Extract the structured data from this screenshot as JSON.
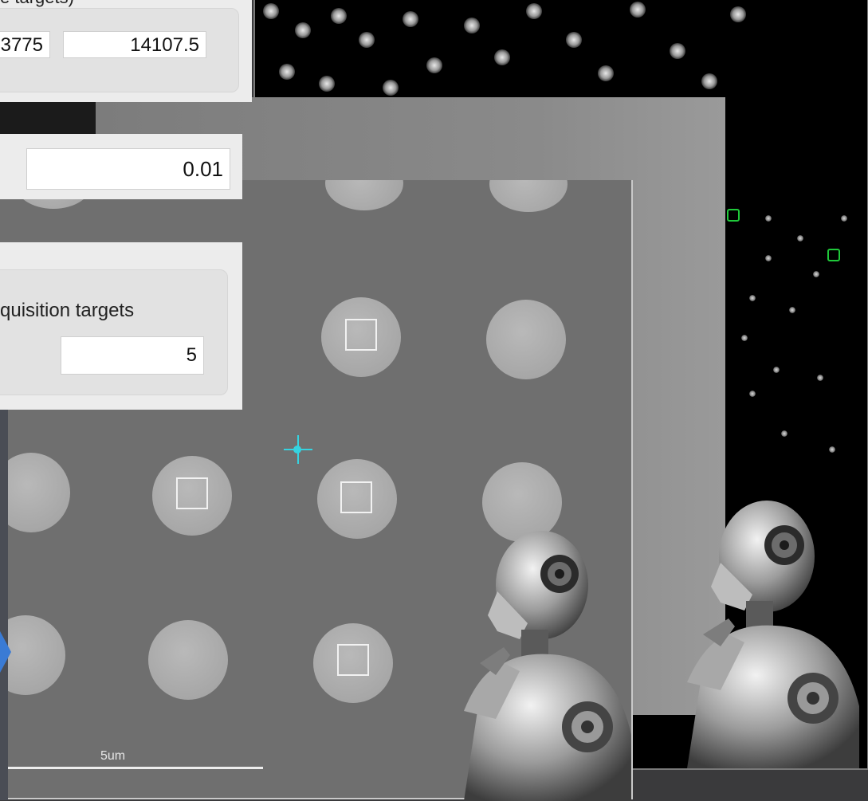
{
  "panel_top": {
    "header_text": "e targets)",
    "field_x_value": "3775",
    "field_y_value": "14107.5"
  },
  "panel_mid": {
    "field_value": "0.01"
  },
  "panel_acq": {
    "label": "quisition targets",
    "field_value": "5"
  },
  "grid_image": {
    "scale_label": "5um"
  },
  "colors": {
    "accent": "#3a7bd5",
    "cursor": "#35d3e0",
    "detection_marker": "#1fc93a"
  },
  "icons": [
    "crosshair-cursor-icon",
    "arrow-right-icon",
    "robot-illustration"
  ]
}
